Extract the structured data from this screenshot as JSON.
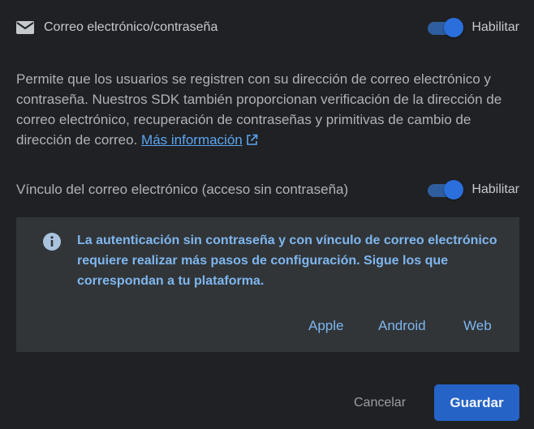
{
  "email_provider": {
    "title": "Correo electrónico/contraseña",
    "icon": "mail-icon",
    "toggle": {
      "enabled": true,
      "label": "Habilitar"
    }
  },
  "description": {
    "text": "Permite que los usuarios se registren con su dirección de correo electrónico y contraseña. Nuestros SDK también proporcionan verificación de la dirección de correo electrónico, recuperación de contraseñas y primitivas de cambio de dirección de correo.",
    "link_label": "Más información",
    "link_icon": "external-link-icon"
  },
  "email_link": {
    "title": "Vínculo del correo electrónico (acceso sin contraseña)",
    "toggle": {
      "enabled": true,
      "label": "Habilitar"
    }
  },
  "info_box": {
    "icon": "info-icon",
    "text": "La autenticación sin contraseña y con vínculo de correo electrónico requiere realizar más pasos de configuración. Sigue los que correspondan a tu plataforma.",
    "platforms": [
      "Apple",
      "Android",
      "Web"
    ]
  },
  "actions": {
    "cancel_label": "Cancelar",
    "save_label": "Guardar"
  },
  "colors": {
    "background": "#202124",
    "info_background": "#313538",
    "accent": "#2563c7",
    "link": "#5aa6f2",
    "info_text": "#7fb6ee"
  }
}
